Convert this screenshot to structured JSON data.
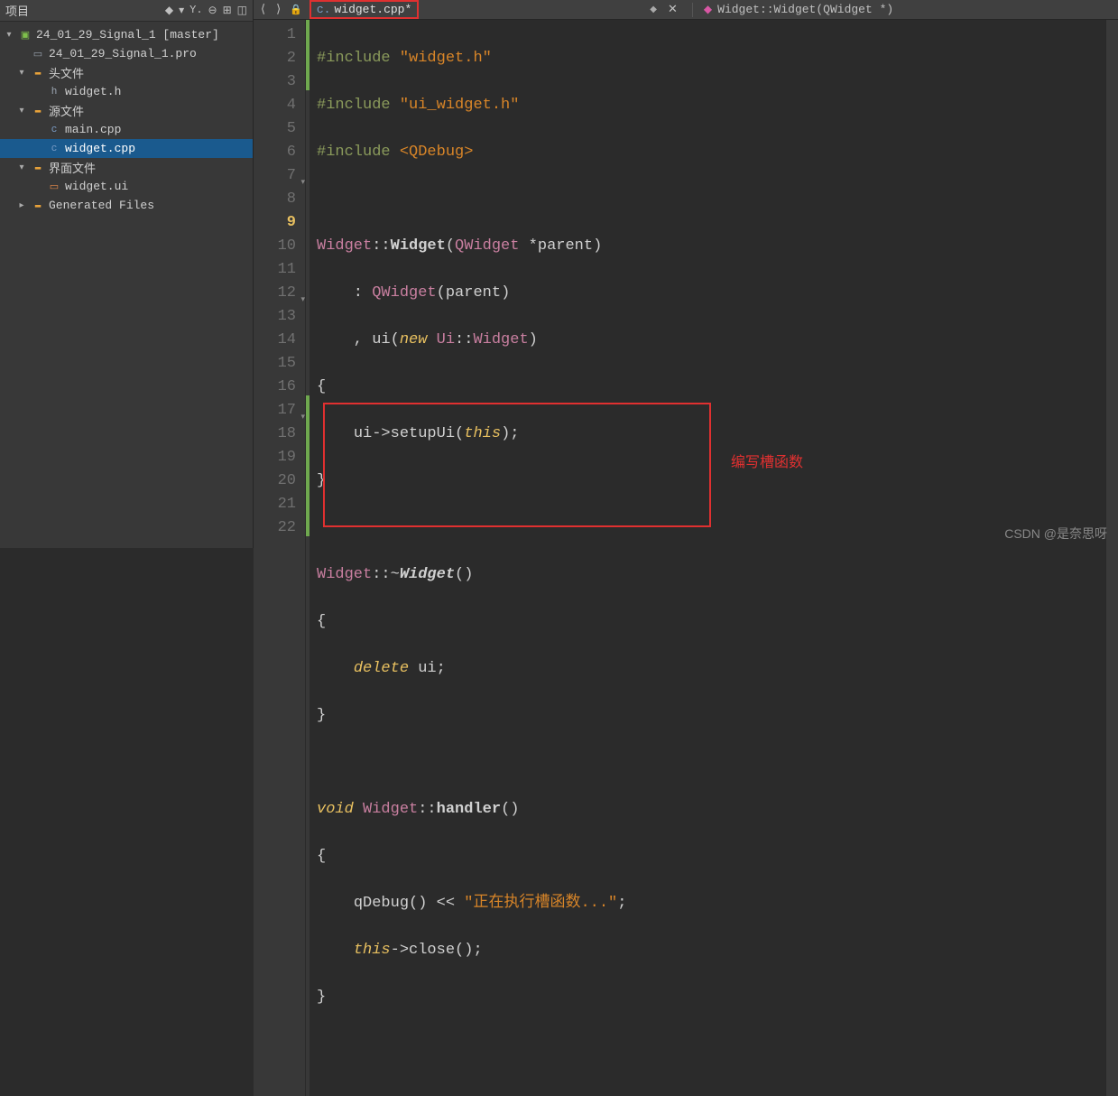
{
  "sidebar": {
    "title": "项目",
    "tree": {
      "project": "24_01_29_Signal_1 [master]",
      "pro_file": "24_01_29_Signal_1.pro",
      "headers_label": "头文件",
      "header_file": "widget.h",
      "sources_label": "源文件",
      "src_main": "main.cpp",
      "src_widget": "widget.cpp",
      "forms_label": "界面文件",
      "form_file": "widget.ui",
      "generated_label": "Generated Files"
    }
  },
  "editor": {
    "filename": "widget.cpp*",
    "breadcrumb": "Widget::Widget(QWidget *)",
    "lines": {
      "l1a": "#include",
      "l1b": "\"widget.h\"",
      "l2a": "#include",
      "l2b": "\"ui_widget.h\"",
      "l3a": "#include",
      "l3b": "<QDebug>",
      "l5a": "Widget",
      "l5b": "Widget",
      "l5c": "QWidget",
      "l5d": "parent",
      "l6a": "QWidget",
      "l6b": "parent",
      "l7a": "ui",
      "l7b": "new",
      "l7c": "Ui",
      "l7d": "Widget",
      "l9a": "ui",
      "l9b": "setupUi",
      "l9c": "this",
      "l12a": "Widget",
      "l12b": "Widget",
      "l14a": "delete",
      "l14b": "ui",
      "l17a": "void",
      "l17b": "Widget",
      "l17c": "handler",
      "l19a": "qDebug",
      "l19b": "\"正在执行槽函数...\"",
      "l20a": "this",
      "l20b": "close"
    },
    "line_nums": [
      "1",
      "2",
      "3",
      "4",
      "5",
      "6",
      "7",
      "8",
      "9",
      "10",
      "11",
      "12",
      "13",
      "14",
      "15",
      "16",
      "17",
      "18",
      "19",
      "20",
      "21",
      "22"
    ]
  },
  "annotation": "编写槽函数",
  "watermark": "CSDN @是奈思呀"
}
